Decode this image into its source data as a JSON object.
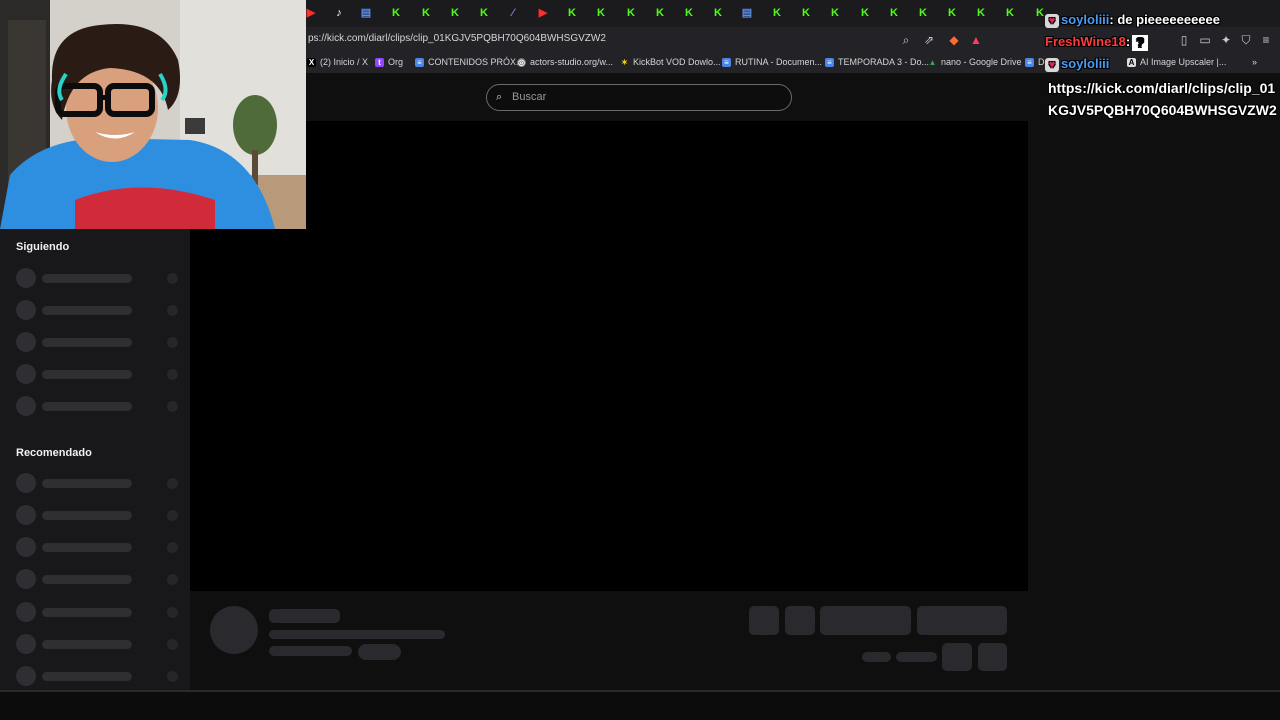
{
  "browser": {
    "url": "ps://kick.com/diarl/clips/clip_01KGJV5PQBH70Q604BWHSGVZW2",
    "bookmarks": [
      {
        "label": "(2) Inicio / X",
        "icon": "x-icon"
      },
      {
        "label": "Org",
        "icon": "twitch-icon"
      },
      {
        "label": "CONTENIDOS PRÓX...",
        "icon": "doc-icon"
      },
      {
        "label": "actors-studio.org/w...",
        "icon": "globe-icon"
      },
      {
        "label": "KickBot VOD Dowlo...",
        "icon": "bot-icon"
      },
      {
        "label": "RUTINA - Documen...",
        "icon": "doc-icon"
      },
      {
        "label": "TEMPORADA 3 - Do...",
        "icon": "doc-icon"
      },
      {
        "label": "nano - Google Drive",
        "icon": "drive-icon"
      },
      {
        "label": "Do",
        "icon": "doc-icon"
      },
      {
        "label": "AI Image Upscaler |...",
        "icon": "ai-icon"
      }
    ],
    "bookmarks_more": "»"
  },
  "search": {
    "placeholder": "Buscar"
  },
  "sidebar": {
    "following_title": "Siguiendo",
    "recommended_title": "Recomendado"
  },
  "chat": {
    "lines": [
      {
        "user": "soyloliii",
        "message": ": de pieeeeeeeeee"
      },
      {
        "user": "FreshWine18",
        "message": ":"
      },
      {
        "user": "soyloliii",
        "message": ""
      }
    ],
    "link_message": "https://kick.com/diarl/clips/clip_01KGJV5PQBH70Q604BWHSGVZW2"
  }
}
